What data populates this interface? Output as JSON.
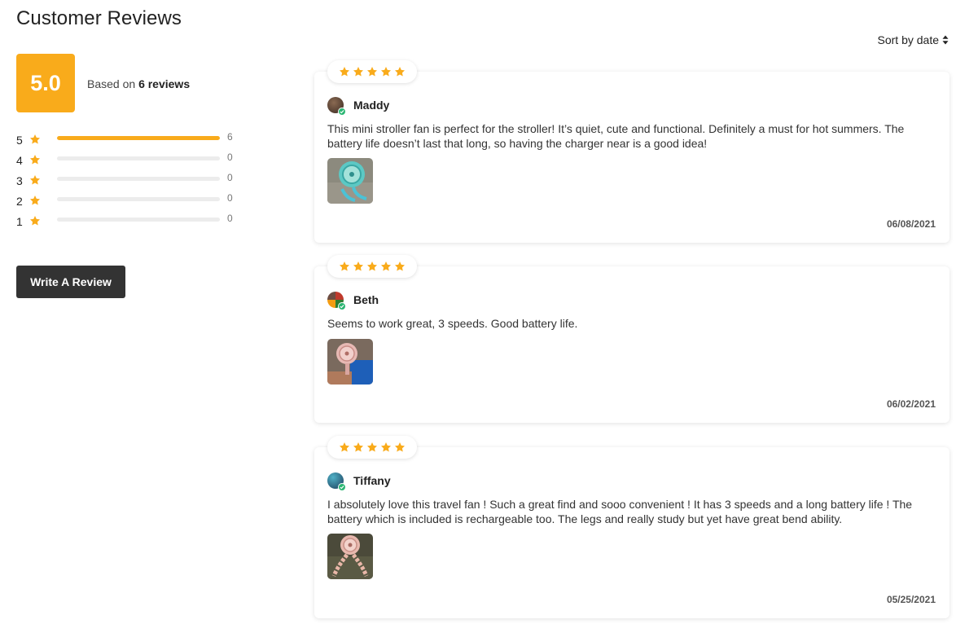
{
  "header": {
    "title": "Customer Reviews"
  },
  "summary": {
    "score": "5.0",
    "based_on_prefix": "Based on",
    "review_count_text": "6 reviews",
    "accent_color": "#f9ab1b"
  },
  "distribution": [
    {
      "stars": "5",
      "count": "6",
      "fraction": 1.0
    },
    {
      "stars": "4",
      "count": "0",
      "fraction": 0
    },
    {
      "stars": "3",
      "count": "0",
      "fraction": 0
    },
    {
      "stars": "2",
      "count": "0",
      "fraction": 0
    },
    {
      "stars": "1",
      "count": "0",
      "fraction": 0
    }
  ],
  "actions": {
    "write_review_label": "Write A Review"
  },
  "sort": {
    "label": "Sort by date",
    "icon": "sort-arrows-icon"
  },
  "reviews": [
    {
      "name": "Maddy",
      "rating": 5,
      "text": "This mini stroller fan is perfect for the stroller! It’s quiet, cute and functional. Definitely a must for hot summers. The battery life doesn’t last that long, so having the charger near is a good idea!",
      "date": "06/08/2021",
      "verified": true
    },
    {
      "name": "Beth",
      "rating": 5,
      "text": "Seems to work great, 3 speeds. Good battery life.",
      "date": "06/02/2021",
      "verified": true
    },
    {
      "name": "Tiffany",
      "rating": 5,
      "text": "I absolutely love this travel fan ! Such a great find and sooo convenient ! It has 3 speeds and a long battery life ! The battery which is included is rechargeable too. The legs and really study but yet have great bend ability.",
      "date": "05/25/2021",
      "verified": true
    }
  ],
  "icons": {
    "star": "star-icon",
    "verified": "verified-check-icon"
  }
}
